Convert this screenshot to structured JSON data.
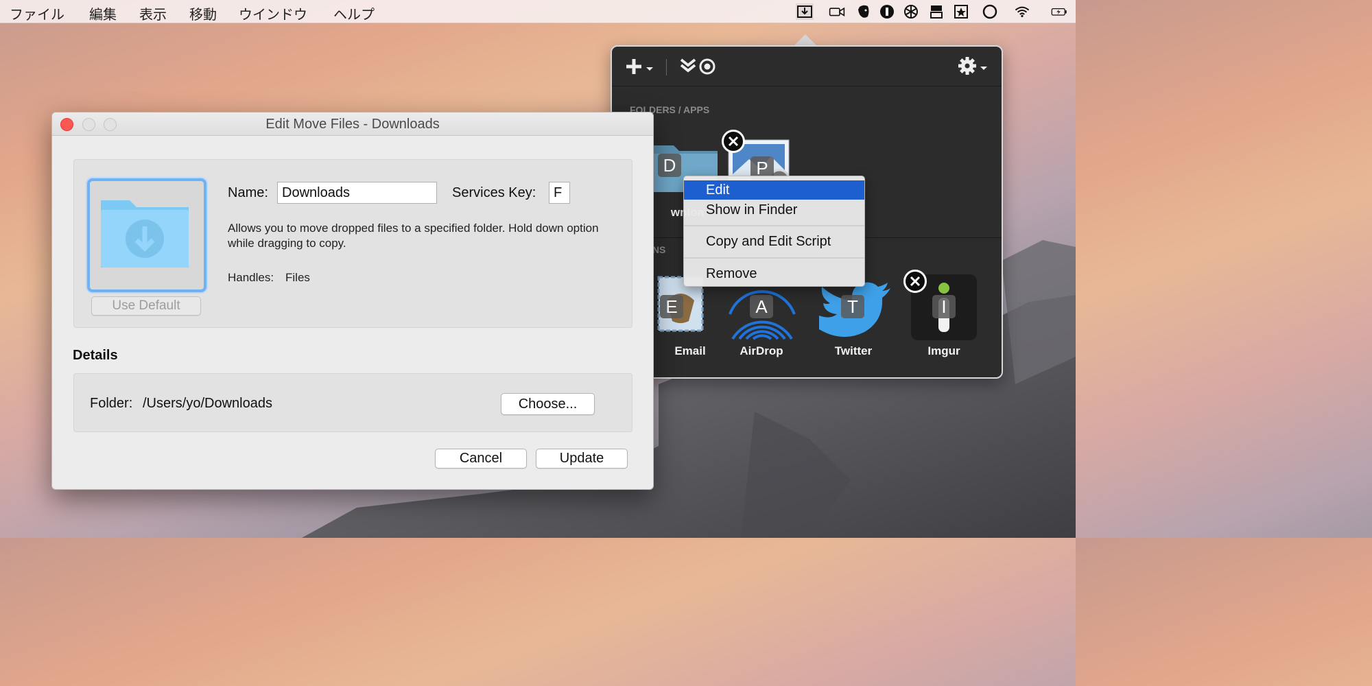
{
  "menubar": {
    "items": [
      "ファイル",
      "編集",
      "表示",
      "移動",
      "ウインドウ",
      "ヘルプ"
    ],
    "status_icons": [
      "dropzone-icon",
      "facetime-icon",
      "evernote-icon",
      "1password-icon",
      "snowflake-icon",
      "columns-icon",
      "star-badge-icon",
      "circle-icon",
      "wifi-icon",
      "battery-icon"
    ]
  },
  "panel": {
    "section_folders": "FOLDERS / APPS",
    "section_actions": "ONS",
    "folders": [
      {
        "label": "wnloa",
        "key": "D",
        "icon": "downloads-folder-icon"
      },
      {
        "label": "",
        "key": "P",
        "icon": "preview-app-icon"
      }
    ],
    "actions": [
      {
        "label": "Email",
        "key": "E",
        "icon": "mail-app-icon"
      },
      {
        "label": "AirDrop",
        "key": "A",
        "icon": "airdrop-icon"
      },
      {
        "label": "Twitter",
        "key": "T",
        "icon": "twitter-icon"
      },
      {
        "label": "Imgur",
        "key": "I",
        "icon": "imgur-icon"
      }
    ]
  },
  "context_menu": {
    "items": [
      "Edit",
      "Show in Finder",
      "Copy and Edit Script",
      "Remove"
    ],
    "selected": "Edit"
  },
  "dialog": {
    "title": "Edit Move Files - Downloads",
    "use_default": "Use Default",
    "name_label": "Name:",
    "name_value": "Downloads",
    "services_key_label": "Services Key:",
    "services_key_value": "F",
    "description": "Allows you to move dropped files to a specified folder. Hold down option while dragging to copy.",
    "handles_label": "Handles:",
    "handles_value": "Files",
    "details_heading": "Details",
    "folder_label": "Folder:",
    "folder_value": "/Users/yo/Downloads",
    "choose_button": "Choose...",
    "cancel_button": "Cancel",
    "update_button": "Update"
  },
  "colors": {
    "panel_bg": "#2c2c2c",
    "selection_blue": "#1e5fcf",
    "close_red": "#fc5753",
    "folder_blue": "#8fd3fb"
  }
}
